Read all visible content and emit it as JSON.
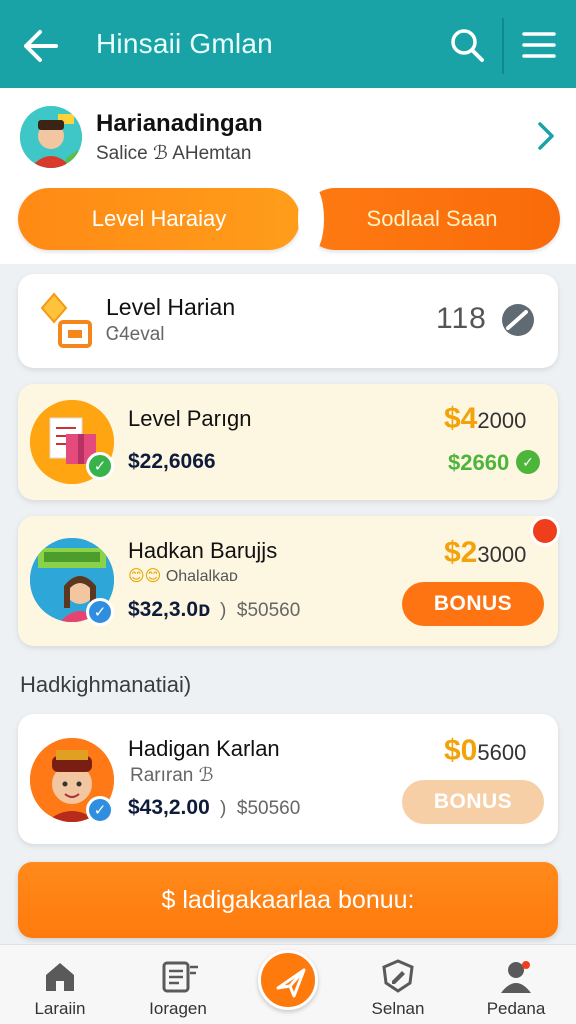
{
  "header": {
    "title": "Hinsaii Gmlan",
    "back_icon": "arrow-left-icon",
    "search_icon": "search-icon",
    "menu_icon": "hamburger-menu-icon"
  },
  "profile": {
    "name": "Harianadingan",
    "subtitle": "Salice ℬ AHemtan",
    "chevron_icon": "chevron-right-icon"
  },
  "tabs": [
    {
      "label": "Level Haraiay",
      "active": true
    },
    {
      "label": "Sodlaal Saan",
      "active": false
    }
  ],
  "cards": [
    {
      "title": "Level Harian",
      "subtitle": "Ꮳ4eval",
      "count": "118",
      "icon": "diamond-icon",
      "status_icon": "gauge-icon"
    },
    {
      "title": "Level Parıgn",
      "price": "$22,6066",
      "amount_big": "$4",
      "amount_small": "2000",
      "green_amount": "$2660",
      "icon": "gift-box-icon",
      "badge_icon": "check-icon"
    },
    {
      "title": "Hadkan Barujjs",
      "emoji_text": "Ohalalkaᴅ",
      "price": "$32,3.0ᴅ",
      "old_price": "$50560",
      "amount_big": "$2",
      "amount_small": "3000",
      "button": "BONUS",
      "icon": "character-girl-icon",
      "badge_icon": "check-icon"
    }
  ],
  "section_label": "Hadkighmanatiai)",
  "card4": {
    "title": "Hadigan Karlan",
    "subtitle": "Rarıran ℬ",
    "price": "$43,2.00",
    "old_price": "$50560",
    "amount_big": "$0",
    "amount_small": "5600",
    "button": "BONUS",
    "icon": "character-boy-icon",
    "badge_icon": "check-icon"
  },
  "cta": {
    "label": "$ ladigakaarlaa  bonuu:"
  },
  "nav": [
    {
      "label": "Laraiin",
      "icon": "home-icon"
    },
    {
      "label": "Ioragen",
      "icon": "document-list-icon"
    },
    {
      "label": "",
      "icon": "send-icon"
    },
    {
      "label": "Selnan",
      "icon": "shield-edit-icon"
    },
    {
      "label": "Pedana",
      "icon": "person-icon"
    }
  ],
  "colors": {
    "header": "#19a3a6",
    "accent": "#ff7a0c",
    "gold": "#f2a20a",
    "green": "#4cb53a"
  }
}
